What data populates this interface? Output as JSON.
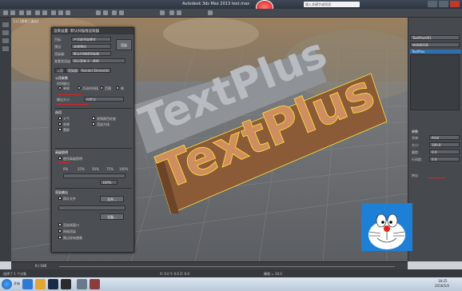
{
  "titlebar": {
    "title": "Autodesk 3ds Max 2013   text.max",
    "search_placeholder": "键入关键字或短语"
  },
  "viewport": {
    "label": "[+] [透视] [真实]",
    "front_text": "TextPlus",
    "back_text": "TextPlus",
    "front_color": "#c8875a",
    "back_color": "#a9acb0",
    "outline_color": "#ffe23a"
  },
  "dialog": {
    "title": "渲染设置: 默认扫描线渲染器",
    "rows": [
      {
        "label": "目标:",
        "value": "产品级渲染模式"
      },
      {
        "label": "预设:",
        "value": "选择预设"
      },
      {
        "label": "渲染器:",
        "value": "默认扫描线渲染器"
      },
      {
        "label": "查看到渲染:",
        "value": "四元菜单 4 - 透视"
      }
    ],
    "render_button": "渲染",
    "tabs": [
      "公用",
      "渲染器",
      "Render Elements"
    ],
    "group1": {
      "title": "公用参数",
      "time_output": "时间输出",
      "options": [
        "单帧",
        "活动时间段",
        "范围",
        "帧"
      ],
      "output_size": "输出大小",
      "size_value": "自定义"
    },
    "group2": {
      "title": "选项",
      "checks": [
        "大气",
        "效果",
        "置换",
        "视频颜色检查",
        "渲染为场"
      ]
    },
    "group3": {
      "title": "高级照明",
      "label": "使用高级照明",
      "preset": "默认",
      "pct": [
        "0%",
        "25%",
        "50%",
        "75%",
        "100%"
      ],
      "quality": "100%"
    },
    "group4": {
      "title": "渲染输出",
      "label": "保存文件",
      "file_label": "文件...",
      "device": "设备...",
      "frame_window": "渲染帧窗口",
      "net_render": "网络渲染",
      "skip": "跳过现有图像"
    }
  },
  "cmdpanel": {
    "object_name": "TextPlus001",
    "modifier_list": "修改器列表",
    "stack_item": "TextPlus",
    "section": "参数",
    "fields": [
      {
        "label": "字体:",
        "value": "Arial"
      },
      {
        "label": "大小:",
        "value": "100.0"
      },
      {
        "label": "跟踪:",
        "value": "0.0"
      },
      {
        "label": "行间距:",
        "value": "0.0"
      }
    ],
    "highlight": "挤出"
  },
  "timeline": {
    "frame": "0 / 100"
  },
  "statusbar": {
    "left": "选择了 1 个对象",
    "coords": "X: 0.0  Y: 0.0  Z: 0.0",
    "grid": "栅格 = 10.0"
  },
  "taskbar": {
    "start": "开始",
    "time": "18:25",
    "date": "2016/5/4"
  }
}
